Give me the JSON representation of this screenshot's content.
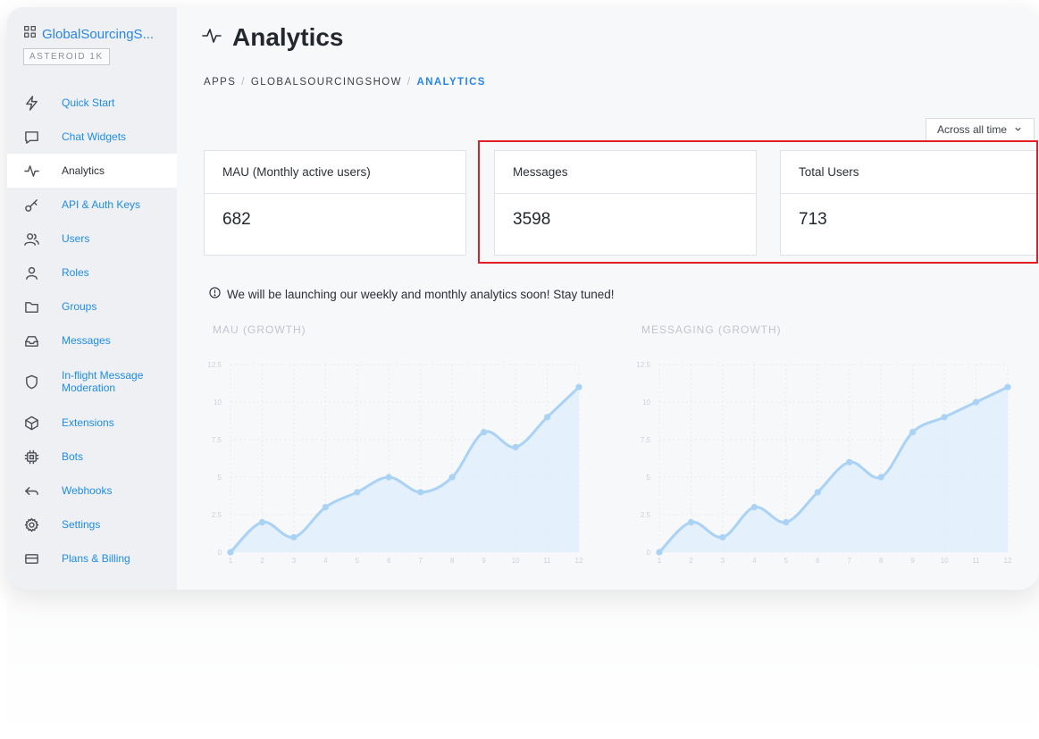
{
  "app": {
    "name": "GlobalSourcingS...",
    "plan": "ASTEROID 1K"
  },
  "sidebar": {
    "items": [
      {
        "label": "Quick Start",
        "icon": "bolt-icon"
      },
      {
        "label": "Chat Widgets",
        "icon": "chat-icon"
      },
      {
        "label": "Analytics",
        "icon": "pulse-icon",
        "active": true
      },
      {
        "label": "API & Auth Keys",
        "icon": "key-icon"
      },
      {
        "label": "Users",
        "icon": "users-icon"
      },
      {
        "label": "Roles",
        "icon": "user-icon"
      },
      {
        "label": "Groups",
        "icon": "folder-icon"
      },
      {
        "label": "Messages",
        "icon": "inbox-icon"
      },
      {
        "label": "In-flight Message Moderation",
        "icon": "shield-icon"
      },
      {
        "label": "Extensions",
        "icon": "cube-icon"
      },
      {
        "label": "Bots",
        "icon": "chip-icon"
      },
      {
        "label": "Webhooks",
        "icon": "return-icon"
      },
      {
        "label": "Settings",
        "icon": "gear-icon"
      },
      {
        "label": "Plans & Billing",
        "icon": "card-icon"
      }
    ]
  },
  "header": {
    "title": "Analytics",
    "breadcrumb": [
      "APPS",
      "GLOBALSOURCINGSHOW",
      "ANALYTICS"
    ]
  },
  "range": {
    "selected": "Across all time"
  },
  "stats": [
    {
      "label": "MAU (Monthly active users)",
      "value": "682"
    },
    {
      "label": "Messages",
      "value": "3598"
    },
    {
      "label": "Total Users",
      "value": "713"
    }
  ],
  "notice": "We will be launching our weekly and monthly analytics soon! Stay tuned!",
  "colors": {
    "accent": "#2a86e6",
    "highlight": "#e41e26",
    "chart_line": "#a9d2f5",
    "chart_fill": "#deedfb"
  },
  "chart_data": [
    {
      "type": "area",
      "title": "MAU (GROWTH)",
      "x": [
        1,
        2,
        3,
        4,
        5,
        6,
        7,
        8,
        9,
        10,
        11,
        12
      ],
      "series": [
        {
          "values": [
            0,
            2,
            1,
            3,
            4,
            5,
            4,
            5,
            8,
            7,
            9,
            11
          ]
        }
      ],
      "ylim": [
        0,
        12.5
      ],
      "yticks": [
        "0",
        "2.5",
        "5",
        "7.5",
        "10",
        "12.5"
      ],
      "grid": true
    },
    {
      "type": "area",
      "title": "MESSAGING (GROWTH)",
      "x": [
        1,
        2,
        3,
        4,
        5,
        6,
        7,
        8,
        9,
        10,
        11,
        12
      ],
      "series": [
        {
          "values": [
            0,
            2,
            1,
            3,
            2,
            4,
            6,
            5,
            8,
            9,
            10,
            11
          ]
        }
      ],
      "ylim": [
        0,
        12.5
      ],
      "yticks": [
        "0",
        "2.5",
        "5",
        "7.5",
        "10",
        "12.5"
      ],
      "grid": true
    }
  ]
}
